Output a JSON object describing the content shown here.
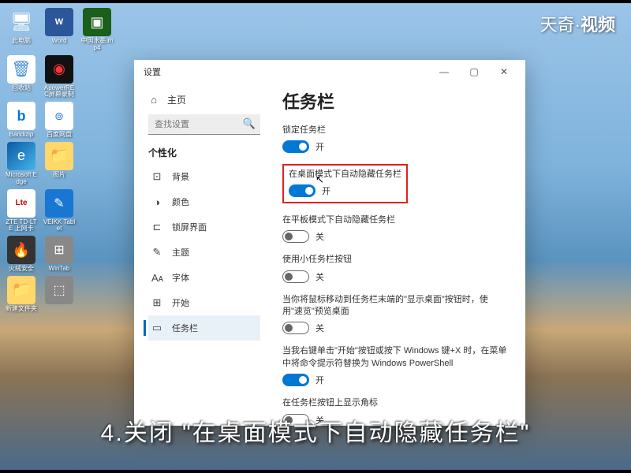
{
  "watermark": {
    "left": "天奇·",
    "right": "视频"
  },
  "subtitle": "4.关闭 \"在桌面模式下自动隐藏任务栏\"",
  "desktop_icons": [
    [
      {
        "name": "pc",
        "cls": "bg-pc",
        "glyph": "🖥",
        "label": "此电脑"
      },
      {
        "name": "word",
        "cls": "bg-word",
        "glyph": "W",
        "label": "Word"
      },
      {
        "name": "mp4",
        "cls": "bg-mp4",
        "glyph": "▣",
        "label": "中国水墨.mp4"
      }
    ],
    [
      {
        "name": "bin",
        "cls": "bg-bin",
        "glyph": "🗑",
        "label": "回收站"
      },
      {
        "name": "rec",
        "cls": "bg-rec",
        "glyph": "◉",
        "label": "ApowerREC屏幕录制"
      }
    ],
    [
      {
        "name": "bandizip",
        "cls": "bg-bandizip",
        "glyph": "b",
        "label": "Bandizip"
      },
      {
        "name": "baidu",
        "cls": "bg-baidu",
        "glyph": "⊚",
        "label": "百度网盘"
      }
    ],
    [
      {
        "name": "edge",
        "cls": "bg-edge",
        "glyph": "e",
        "label": "Microsoft Edge"
      },
      {
        "name": "folder1",
        "cls": "bg-folder",
        "glyph": "📁",
        "label": "图片"
      }
    ],
    [
      {
        "name": "lte",
        "cls": "bg-lte",
        "glyph": "Lte",
        "label": "ZTE TD-LTE 上网卡"
      },
      {
        "name": "veikk",
        "cls": "bg-veikk",
        "glyph": "✎",
        "label": "VEIKK Tablet"
      }
    ],
    [
      {
        "name": "fire",
        "cls": "bg-fire",
        "glyph": "🔥",
        "label": "火绒安全"
      },
      {
        "name": "wintab",
        "cls": "bg-generic",
        "glyph": "⊞",
        "label": "WinTab"
      }
    ],
    [
      {
        "name": "folder2",
        "cls": "bg-folder",
        "glyph": "📁",
        "label": "新建文件夹"
      },
      {
        "name": "other",
        "cls": "bg-generic",
        "glyph": "⬚",
        "label": ""
      }
    ]
  ],
  "window": {
    "title": "设置",
    "controls": {
      "min": "—",
      "max": "▢",
      "close": "✕"
    }
  },
  "sidebar": {
    "home": "主页",
    "search_placeholder": "查找设置",
    "section": "个性化",
    "items": [
      {
        "id": "background",
        "icon": "⊡",
        "label": "背景"
      },
      {
        "id": "colors",
        "icon": "◑",
        "label": "颜色"
      },
      {
        "id": "lockscreen",
        "icon": "⊏",
        "label": "锁屏界面"
      },
      {
        "id": "themes",
        "icon": "✎",
        "label": "主题"
      },
      {
        "id": "fonts",
        "icon": "Aᴀ",
        "label": "字体"
      },
      {
        "id": "start",
        "icon": "⊞",
        "label": "开始"
      },
      {
        "id": "taskbar",
        "icon": "▭",
        "label": "任务栏",
        "active": true
      }
    ]
  },
  "content": {
    "heading": "任务栏",
    "settings": [
      {
        "id": "lock",
        "label": "锁定任务栏",
        "on": true,
        "state": "开"
      },
      {
        "id": "autohide-desktop",
        "label": "在桌面模式下自动隐藏任务栏",
        "on": true,
        "state": "开",
        "highlighted": true
      },
      {
        "id": "autohide-tablet",
        "label": "在平板模式下自动隐藏任务栏",
        "on": false,
        "state": "关"
      },
      {
        "id": "small-buttons",
        "label": "使用小任务栏按钮",
        "on": false,
        "state": "关"
      },
      {
        "id": "peek",
        "label": "当你将鼠标移动到任务栏末端的\"显示桌面\"按钮时，使用\"速览\"预览桌面",
        "on": false,
        "state": "关"
      },
      {
        "id": "powershell",
        "label": "当我右键单击\"开始\"按钮或按下 Windows 键+X 时，在菜单中将命令提示符替换为 Windows PowerShell",
        "on": true,
        "state": "开"
      },
      {
        "id": "badges",
        "label": "在任务栏按钮上显示角标",
        "on": false,
        "state": "关"
      }
    ]
  }
}
